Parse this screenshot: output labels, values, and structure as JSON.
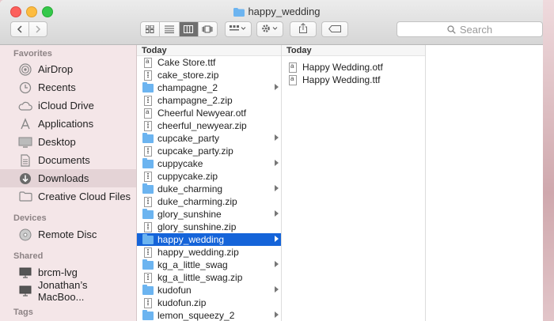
{
  "window": {
    "title": "happy_wedding"
  },
  "toolbar": {
    "search_placeholder": "Search",
    "icons": [
      "back-icon",
      "forward-icon",
      "icon-view-icon",
      "list-view-icon",
      "column-view-icon",
      "cover-flow-icon",
      "arrange-icon",
      "action-gear-icon",
      "share-icon",
      "tag-icon"
    ]
  },
  "sidebar": {
    "favorites_header": "Favorites",
    "favorites": [
      {
        "label": "AirDrop",
        "icon": "airdrop-icon"
      },
      {
        "label": "Recents",
        "icon": "clock-icon"
      },
      {
        "label": "iCloud Drive",
        "icon": "cloud-icon"
      },
      {
        "label": "Applications",
        "icon": "applications-icon"
      },
      {
        "label": "Desktop",
        "icon": "desktop-icon"
      },
      {
        "label": "Documents",
        "icon": "document-icon"
      },
      {
        "label": "Downloads",
        "icon": "download-icon",
        "selected": true
      },
      {
        "label": "Creative Cloud Files",
        "icon": "folder-icon"
      }
    ],
    "devices_header": "Devices",
    "devices": [
      {
        "label": "Remote Disc",
        "icon": "disc-icon"
      }
    ],
    "shared_header": "Shared",
    "shared": [
      {
        "label": "brcm-lvg",
        "icon": "monitor-icon"
      },
      {
        "label": "Jonathan’s MacBoo...",
        "icon": "monitor-icon"
      }
    ],
    "tags_header": "Tags"
  },
  "column1": {
    "header": "Today",
    "items": [
      {
        "name": "Cake Store.ttf",
        "type": "font"
      },
      {
        "name": "cake_store.zip",
        "type": "zip"
      },
      {
        "name": "champagne_2",
        "type": "folder"
      },
      {
        "name": "champagne_2.zip",
        "type": "zip"
      },
      {
        "name": "Cheerful Newyear.otf",
        "type": "font"
      },
      {
        "name": "cheerful_newyear.zip",
        "type": "zip"
      },
      {
        "name": "cupcake_party",
        "type": "folder"
      },
      {
        "name": "cupcake_party.zip",
        "type": "zip"
      },
      {
        "name": "cuppycake",
        "type": "folder"
      },
      {
        "name": "cuppycake.zip",
        "type": "zip"
      },
      {
        "name": "duke_charming",
        "type": "folder"
      },
      {
        "name": "duke_charming.zip",
        "type": "zip"
      },
      {
        "name": "glory_sunshine",
        "type": "folder"
      },
      {
        "name": "glory_sunshine.zip",
        "type": "zip"
      },
      {
        "name": "happy_wedding",
        "type": "folder",
        "selected": true
      },
      {
        "name": "happy_wedding.zip",
        "type": "zip"
      },
      {
        "name": "kg_a_little_swag",
        "type": "folder"
      },
      {
        "name": "kg_a_little_swag.zip",
        "type": "zip"
      },
      {
        "name": "kudofun",
        "type": "folder"
      },
      {
        "name": "kudofun.zip",
        "type": "zip"
      },
      {
        "name": "lemon_squeezy_2",
        "type": "folder"
      }
    ]
  },
  "column2": {
    "header": "Today",
    "items": [
      {
        "name": "Happy Wedding.otf",
        "type": "font"
      },
      {
        "name": "Happy Wedding.ttf",
        "type": "font"
      }
    ]
  }
}
